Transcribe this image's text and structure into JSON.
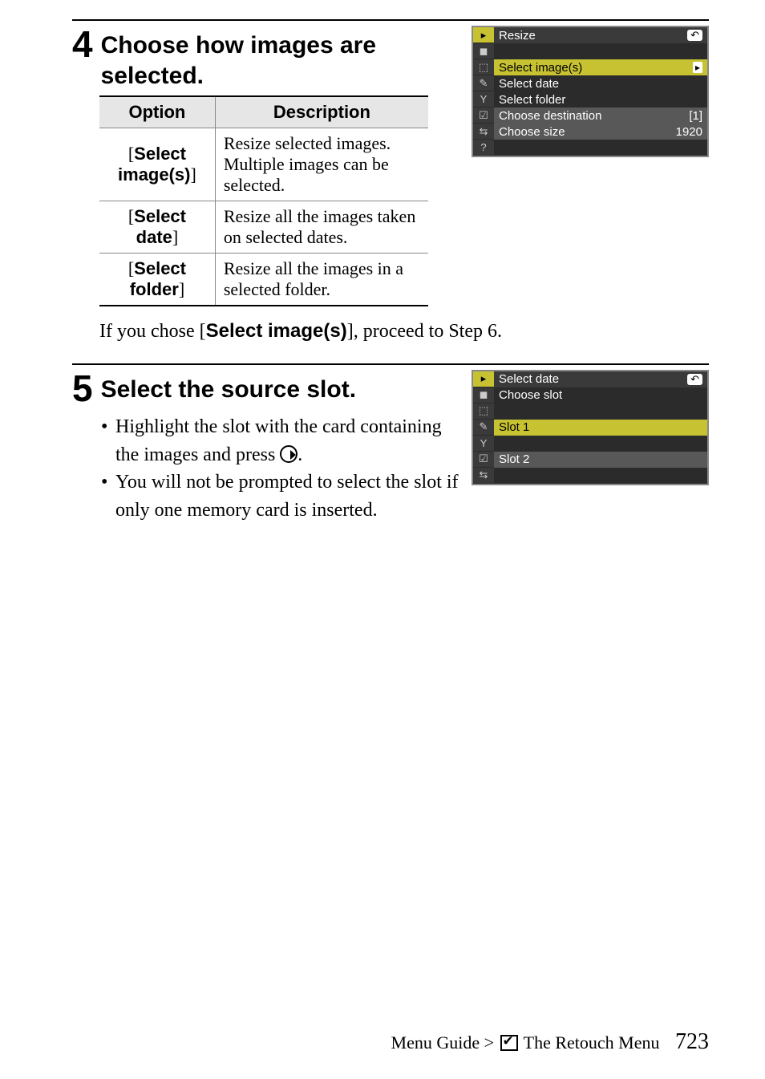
{
  "step4": {
    "number": "4",
    "title": "Choose how images are selected.",
    "table": {
      "headers": [
        "Option",
        "Description"
      ],
      "rows": [
        {
          "option_open": "[",
          "option_bold": "Select image(s)",
          "option_close": "]",
          "desc": "Resize selected images. Multiple images can be selected."
        },
        {
          "option_open": "[",
          "option_bold": "Select date",
          "option_close": "]",
          "desc": "Resize all the images taken on selected dates."
        },
        {
          "option_open": "[",
          "option_bold": "Select folder",
          "option_close": "]",
          "desc": "Resize all the images in a selected folder."
        }
      ]
    },
    "after_text_pre": "If you chose [",
    "after_text_bold": "Select image(s)",
    "after_text_post": "], proceed to Step 6.",
    "screenshot": {
      "title": "Resize",
      "items": [
        {
          "label": "Select image(s)",
          "right": "▸",
          "sel": true
        },
        {
          "label": "Select date",
          "sel": false
        },
        {
          "label": "Select folder",
          "sel": false
        },
        {
          "label": "Choose destination",
          "right": "[1]",
          "sel": false,
          "mid": true
        },
        {
          "label": "Choose size",
          "right": "1920",
          "sel": false,
          "mid": true
        }
      ],
      "sidebar": [
        "▸",
        "◼",
        "⬚",
        "✎",
        "Y",
        "☑",
        "⇆",
        "?"
      ]
    }
  },
  "step5": {
    "number": "5",
    "title": "Select the source slot.",
    "bullets": [
      "Highlight the slot with the card containing the images and press ",
      "You will not be prompted to select the slot if only one memory card is inserted."
    ],
    "screenshot": {
      "title": "Select date",
      "subtitle": "Choose slot",
      "items": [
        {
          "label": "Slot 1",
          "sel": true
        },
        {
          "label": "Slot 2",
          "sel": false,
          "mid": true
        }
      ],
      "sidebar": [
        "▸",
        "◼",
        "⬚",
        "✎",
        "Y",
        "☑",
        "⇆"
      ]
    }
  },
  "footer": {
    "menu_guide": "Menu Guide",
    "gt": ">",
    "the_retouch_menu": "The Retouch Menu",
    "page": "723"
  }
}
